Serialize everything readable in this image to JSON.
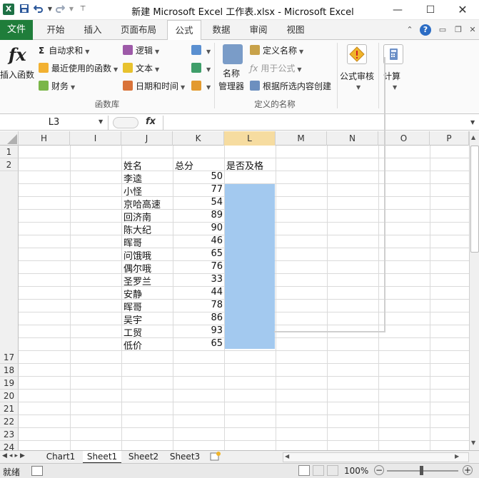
{
  "window": {
    "title": "新建 Microsoft Excel 工作表.xlsx  -  Microsoft Excel",
    "app_icon_letter": "X"
  },
  "ribbon_tabs": {
    "file": "文件",
    "items": [
      "开始",
      "插入",
      "页面布局",
      "公式",
      "数据",
      "审阅",
      "视图"
    ],
    "active": "公式"
  },
  "ribbon": {
    "insert_function": "插入函数",
    "autosum": "自动求和",
    "recently_used": "最近使用的函数",
    "financial": "财务",
    "logical": "逻辑",
    "text": "文本",
    "date_time": "日期和时间",
    "function_library_label": "函数库",
    "name_manager_line1": "名称",
    "name_manager_line2": "管理器",
    "define_name": "定义名称",
    "use_in_formula": "用于公式",
    "create_from_selection": "根据所选内容创建",
    "defined_names_label": "定义的名称",
    "formula_auditing": "公式审核",
    "calculation": "计算"
  },
  "formula_bar": {
    "name_box": "L3",
    "fx": "fx",
    "formula": ""
  },
  "grid": {
    "columns": [
      "H",
      "I",
      "J",
      "K",
      "L",
      "M",
      "N",
      "O",
      "P"
    ],
    "rows_top": [
      "1",
      "2"
    ],
    "rows_bottom": [
      "17",
      "18",
      "19",
      "20",
      "21",
      "22",
      "23",
      "24"
    ],
    "headers": {
      "name": "姓名",
      "score": "总分",
      "pass": "是否及格"
    },
    "records": [
      {
        "name": "李逵",
        "score": "50"
      },
      {
        "name": "小怪",
        "score": "77"
      },
      {
        "name": "京哈高速",
        "score": "54"
      },
      {
        "name": "回济南",
        "score": "89"
      },
      {
        "name": "陈大纪",
        "score": "90"
      },
      {
        "name": "晖哥",
        "score": "46"
      },
      {
        "name": "问饿哦",
        "score": "65"
      },
      {
        "name": "偶尔哦",
        "score": "76"
      },
      {
        "name": "圣罗兰",
        "score": "33"
      },
      {
        "name": "安静",
        "score": "44"
      },
      {
        "name": "晖哥",
        "score": "78"
      },
      {
        "name": "吴宇",
        "score": "86"
      },
      {
        "name": "工贸",
        "score": "93"
      },
      {
        "name": "低价",
        "score": "65"
      }
    ]
  },
  "sheets": {
    "tabs": [
      "Chart1",
      "Sheet1",
      "Sheet2",
      "Sheet3"
    ],
    "active": "Sheet1"
  },
  "status": {
    "ready": "就绪",
    "zoom": "100%"
  },
  "colors": {
    "excel_green": "#1f7d3a",
    "selection_blue": "#a3c9ef"
  }
}
